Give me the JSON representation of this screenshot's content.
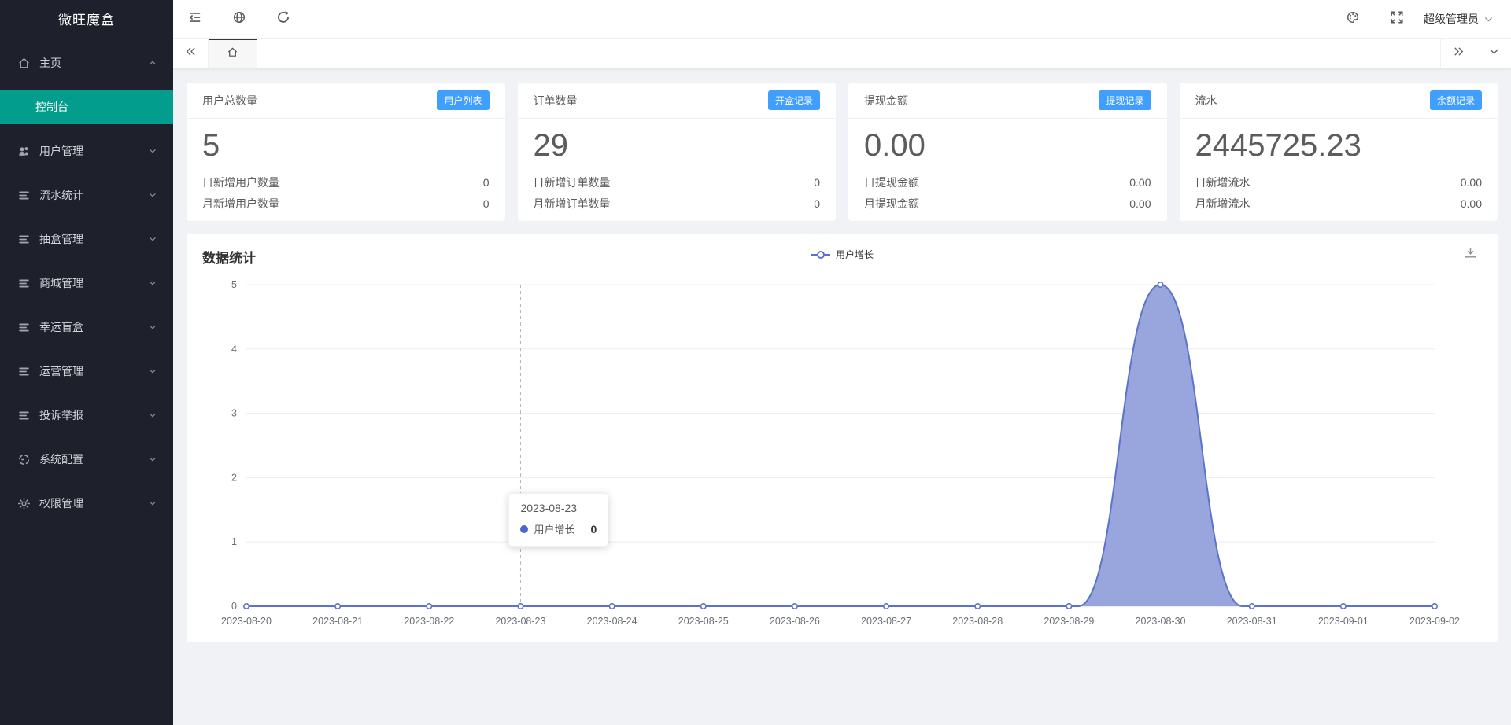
{
  "sidebar": {
    "logo": "微旺魔盒",
    "items": [
      {
        "key": "home",
        "label": "主页",
        "icon": "home-icon",
        "chevron": "up"
      },
      {
        "key": "console",
        "label": "控制台",
        "sub": true,
        "active": true
      },
      {
        "key": "user-manage",
        "label": "用户管理",
        "icon": "users-icon",
        "chevron": "down"
      },
      {
        "key": "flow-stats",
        "label": "流水统计",
        "icon": "list-icon",
        "chevron": "down"
      },
      {
        "key": "draw-box-manage",
        "label": "抽盒管理",
        "icon": "list-icon",
        "chevron": "down"
      },
      {
        "key": "mall-manage",
        "label": "商城管理",
        "icon": "list-icon",
        "chevron": "down"
      },
      {
        "key": "lucky-blind-box",
        "label": "幸运盲盒",
        "icon": "list-icon",
        "chevron": "down"
      },
      {
        "key": "operation-manage",
        "label": "运营管理",
        "icon": "list-icon",
        "chevron": "down"
      },
      {
        "key": "complaint-report",
        "label": "投诉举报",
        "icon": "list-icon",
        "chevron": "down"
      },
      {
        "key": "system-config",
        "label": "系统配置",
        "icon": "config-icon",
        "chevron": "down"
      },
      {
        "key": "permission-manage",
        "label": "权限管理",
        "icon": "gear-icon",
        "chevron": "down"
      }
    ]
  },
  "topbar": {
    "user": "超级管理员"
  },
  "stats": [
    {
      "key": "users",
      "title": "用户总数量",
      "badge": "用户列表",
      "value": "5",
      "rows": [
        {
          "label": "日新增用户数量",
          "value": "0"
        },
        {
          "label": "月新增用户数量",
          "value": "0"
        }
      ]
    },
    {
      "key": "orders",
      "title": "订单数量",
      "badge": "开盒记录",
      "value": "29",
      "rows": [
        {
          "label": "日新增订单数量",
          "value": "0"
        },
        {
          "label": "月新增订单数量",
          "value": "0"
        }
      ]
    },
    {
      "key": "withdraw",
      "title": "提现金额",
      "badge": "提现记录",
      "value": "0.00",
      "rows": [
        {
          "label": "日提现金额",
          "value": "0.00"
        },
        {
          "label": "月提现金额",
          "value": "0.00"
        }
      ]
    },
    {
      "key": "flow",
      "title": "流水",
      "badge": "余额记录",
      "value": "2445725.23",
      "rows": [
        {
          "label": "日新增流水",
          "value": "0.00"
        },
        {
          "label": "月新增流水",
          "value": "0.00"
        }
      ]
    }
  ],
  "chart_card": {
    "title": "数据统计"
  },
  "chart_data": {
    "type": "area",
    "title": "数据统计",
    "categories": [
      "2023-08-20",
      "2023-08-21",
      "2023-08-22",
      "2023-08-23",
      "2023-08-24",
      "2023-08-25",
      "2023-08-26",
      "2023-08-27",
      "2023-08-28",
      "2023-08-29",
      "2023-08-30",
      "2023-08-31",
      "2023-09-01",
      "2023-09-02"
    ],
    "series": [
      {
        "name": "用户增长",
        "values": [
          0,
          0,
          0,
          0,
          0,
          0,
          0,
          0,
          0,
          0,
          5,
          0,
          0,
          0
        ]
      }
    ],
    "ylim": [
      0,
      5
    ],
    "yticks": [
      0,
      1,
      2,
      3,
      4,
      5
    ],
    "grid": true,
    "legend_position": "top-center",
    "smooth": true,
    "line_color": "#5b73c9",
    "fill_color": "#8e9cda",
    "tooltip": {
      "date": "2023-08-23",
      "series": "用户增长",
      "value": "0",
      "category_index": 3
    }
  },
  "colors": {
    "sidebar_active": "#029d8c",
    "badge": "#409eff",
    "chart_line": "#5b73c9",
    "chart_fill": "#8e9cda"
  }
}
